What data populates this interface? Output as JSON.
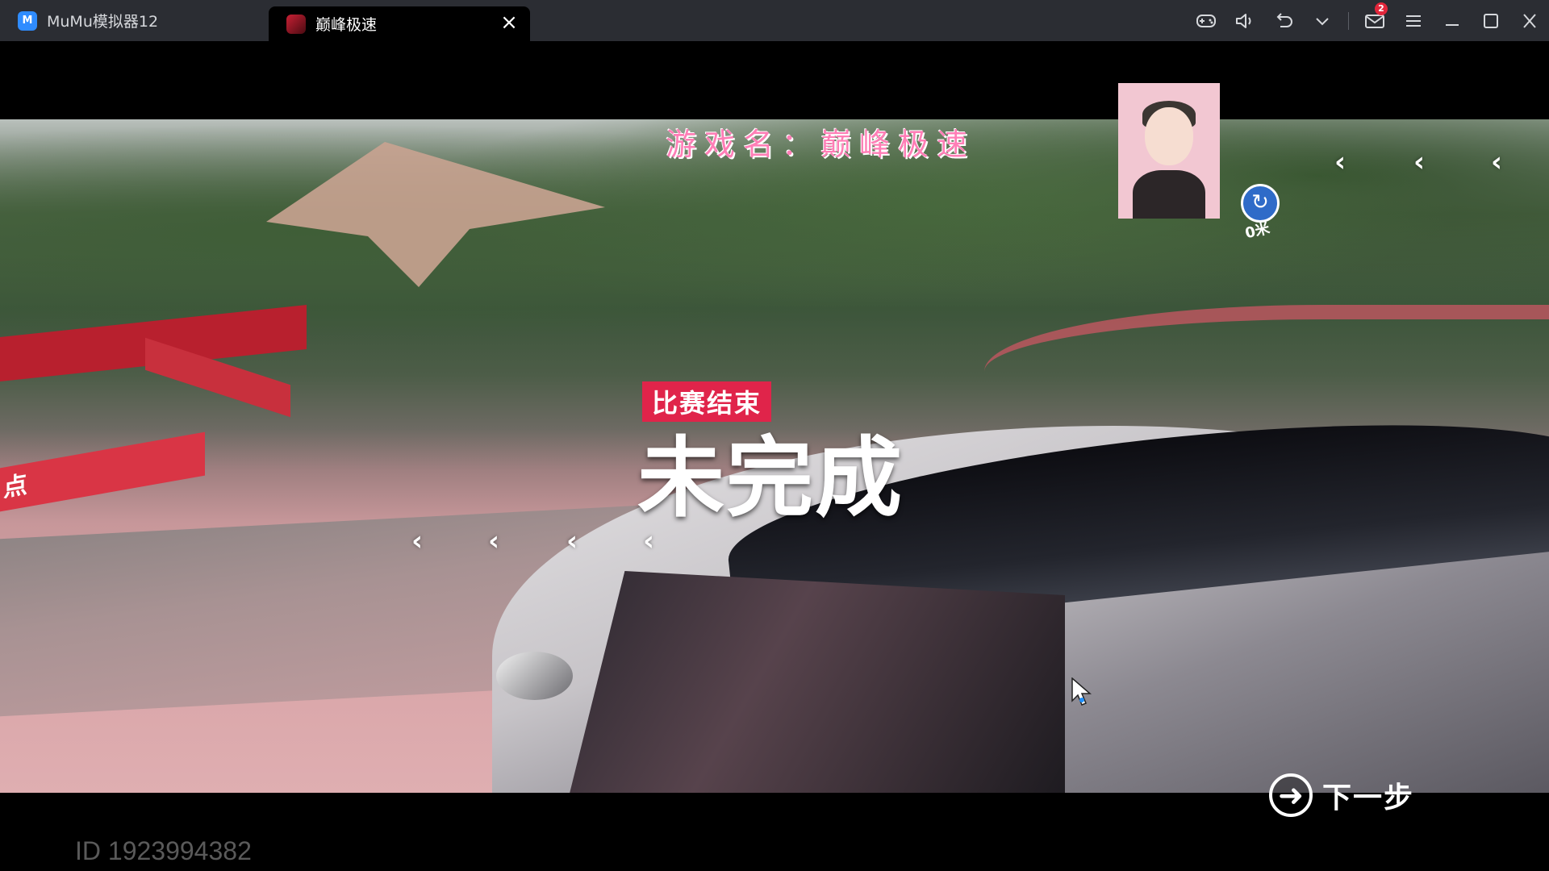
{
  "window": {
    "tabs": [
      {
        "label": "MuMu模拟器12",
        "icon": "mumu-logo-icon",
        "active": false
      },
      {
        "label": "巅峰极速",
        "icon": "game-app-icon",
        "active": true
      }
    ],
    "toolbar_icons": [
      "gamepad-icon",
      "volume-icon",
      "undo-icon",
      "chevron-down-icon",
      "mail-icon",
      "menu-icon",
      "minimize-icon",
      "maximize-icon",
      "close-icon"
    ],
    "mail_badge": "2"
  },
  "game": {
    "title_overlay": "游戏名：巅峰极速",
    "race_status_tag": "比赛结束",
    "result_text": "未完成",
    "distance_label": "0米",
    "banner_text": "点",
    "next_label": "下一步",
    "player_id": "ID 19239943​82"
  },
  "colors": {
    "titlebar": "#2b2d33",
    "accent_pink": "#e0244a",
    "title_overlay": "#ff7eb6",
    "badge": "#e2263b"
  }
}
